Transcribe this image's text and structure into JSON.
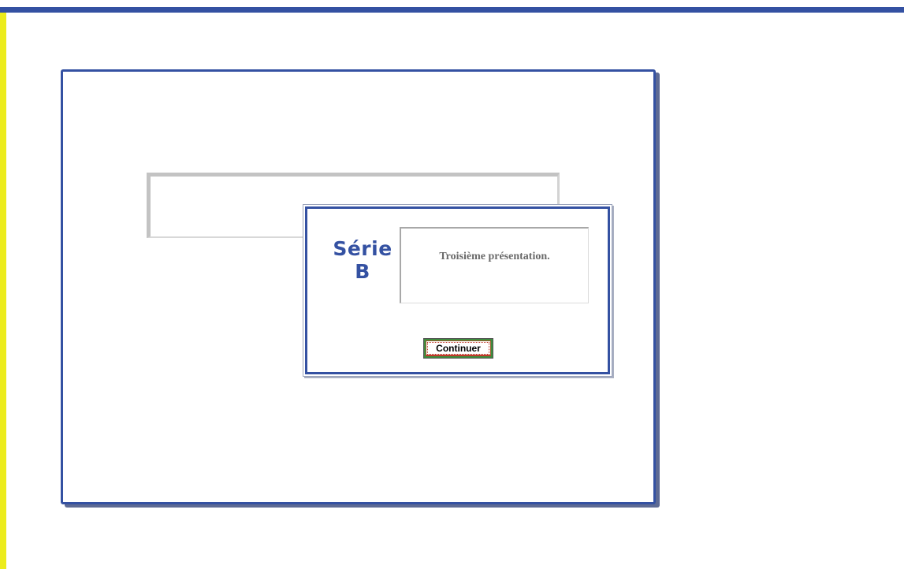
{
  "dialog": {
    "logo_line1": "Série",
    "logo_line2": "B",
    "message": "Troisième présentation.",
    "continue_label": "Continuer"
  },
  "colors": {
    "accent_blue": "#3451a2",
    "left_stripe_yellow": "#ecec1c",
    "button_border_green": "#3e8c3e",
    "button_focus_red": "#c0392b"
  }
}
